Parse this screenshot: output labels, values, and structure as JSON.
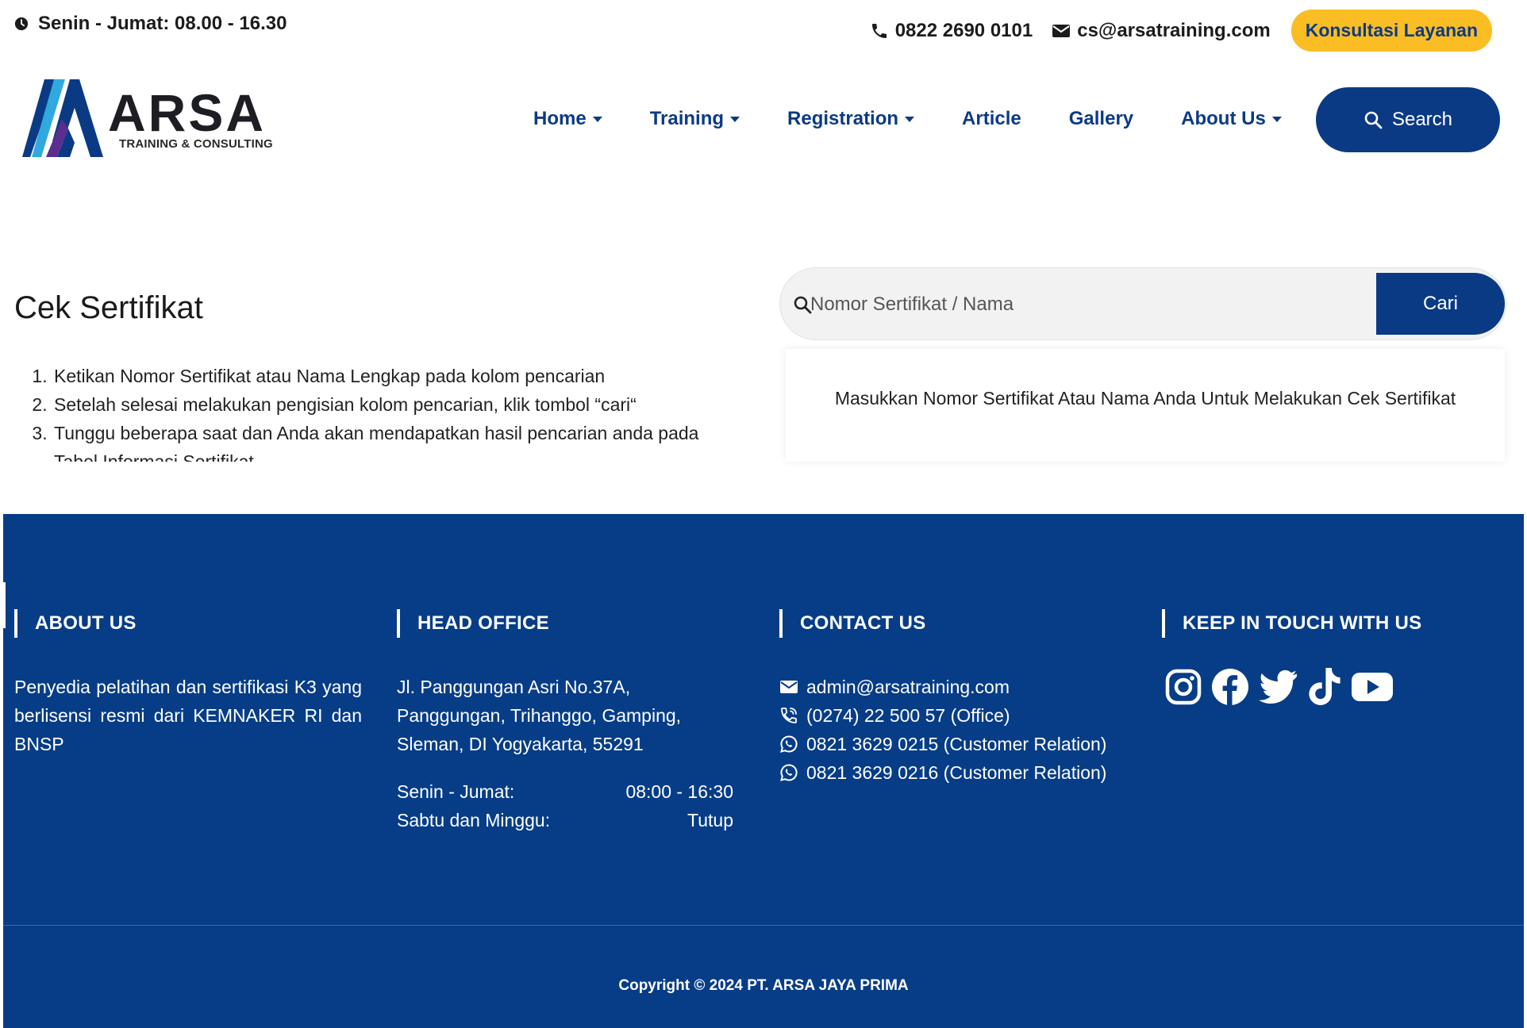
{
  "topbar": {
    "hours": "Senin - Jumat: 08.00 - 16.30",
    "phone": "0822 2690 0101",
    "email": "cs@arsatraining.com",
    "consult_label": "Konsultasi Layanan",
    "consult_color": "#fbbd24"
  },
  "brand": {
    "name": "ARSA",
    "tagline": "TRAINING & CONSULTING",
    "primary_color": "#0b3a85"
  },
  "nav": {
    "items": [
      {
        "label": "Home",
        "dropdown": true
      },
      {
        "label": "Training",
        "dropdown": true
      },
      {
        "label": "Registration",
        "dropdown": true
      },
      {
        "label": "Article",
        "dropdown": false
      },
      {
        "label": "Gallery",
        "dropdown": false
      },
      {
        "label": "About Us",
        "dropdown": true
      }
    ],
    "search_label": "Search"
  },
  "cek": {
    "title": "Cek Sertifikat",
    "steps": [
      "Ketikan Nomor Sertifikat atau Nama Lengkap pada kolom pencarian",
      "Setelah selesai melakukan pengisian kolom pencarian, klik tombol “cari“",
      "Tunggu beberapa saat dan Anda akan mendapatkan hasil pencarian anda pada Tabel Informasi Sertifikat"
    ],
    "search_placeholder": "Nomor Sertifikat / Nama",
    "search_value": "",
    "cari_label": "Cari",
    "result_message": "Masukkan Nomor Sertifikat Atau Nama Anda Untuk Melakukan Cek Sertifikat"
  },
  "footer": {
    "background": "#073d87",
    "about": {
      "title": "ABOUT US",
      "text": "Penyedia pelatihan dan sertifikasi K3 yang berlisensi resmi dari KEMNAKER RI dan BNSP"
    },
    "head_office": {
      "title": "HEAD OFFICE",
      "address_lines": [
        "Jl. Panggungan Asri No.37A,",
        "Panggungan, Trihanggo, Gamping,",
        "Sleman, DI Yogyakarta, 55291"
      ],
      "hours": [
        {
          "day": "Senin - Jumat:",
          "time": "08:00 - 16:30"
        },
        {
          "day": "Sabtu dan Minggu:",
          "time": "Tutup"
        }
      ]
    },
    "contact": {
      "title": "CONTACT US",
      "items": [
        {
          "icon": "envelope-icon",
          "text": "admin@arsatraining.com"
        },
        {
          "icon": "phone-volume-icon",
          "text": "(0274) 22 500 57 (Office)"
        },
        {
          "icon": "whatsapp-icon",
          "text": "0821 3629 0215 (Customer Relation)"
        },
        {
          "icon": "whatsapp-icon",
          "text": "0821 3629 0216 (Customer Relation)"
        }
      ]
    },
    "social": {
      "title": "KEEP IN TOUCH WITH US",
      "icons": [
        "instagram-icon",
        "facebook-icon",
        "twitter-icon",
        "tiktok-icon",
        "youtube-icon"
      ]
    },
    "copyright": "Copyright © 2024 PT. ARSA JAYA PRIMA"
  }
}
